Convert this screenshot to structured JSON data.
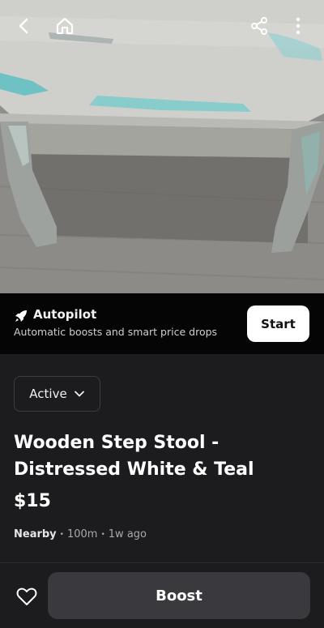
{
  "autopilot": {
    "title": "Autopilot",
    "subtitle": "Automatic boosts and smart price drops",
    "start_label": "Start"
  },
  "listing": {
    "status": "Active",
    "title": "Wooden Step Stool - Distressed White & Teal",
    "price": "$15",
    "location": "Nearby",
    "distance": "100m",
    "age": "1w ago"
  },
  "actions": {
    "boost_label": "Boost"
  },
  "icons": {
    "back": "chevron-left-icon",
    "home": "home-icon",
    "share": "share-icon",
    "more": "more-vertical-icon",
    "autopilot": "rocket-icon",
    "status": "chevron-down-icon",
    "favorite": "heart-icon"
  },
  "colors": {
    "background": "#1c1c1e",
    "banner": "#050505",
    "boost_button": "#3a3a3e",
    "start_button": "#ffffff"
  }
}
